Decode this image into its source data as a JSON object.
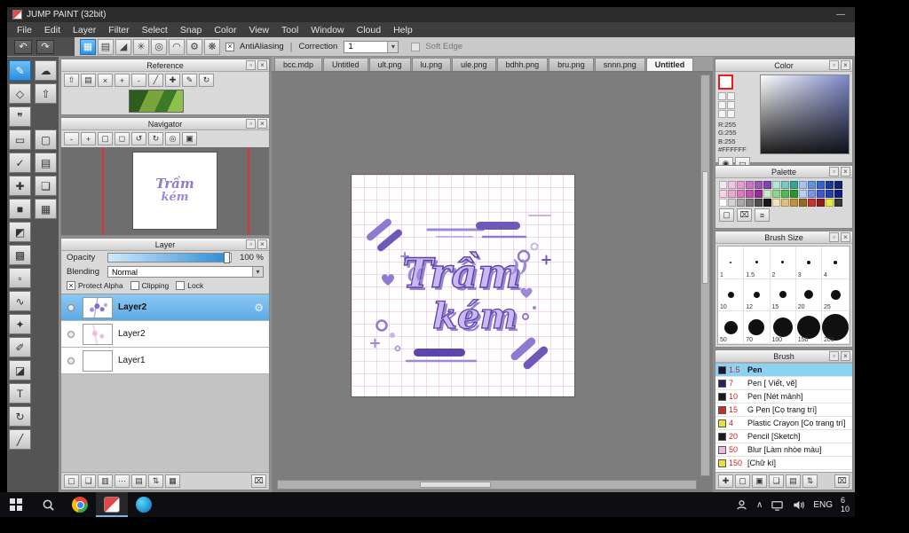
{
  "ui": {
    "dock_glyph": "▫",
    "close_glyph": "×",
    "dropdown_arrow": "▾",
    "check_glyph": "×",
    "gear_glyph": "⚙",
    "undo_glyph": "↶",
    "redo_glyph": "↷",
    "separator": "|",
    "chevron_up_glyph": "∧",
    "palette_lines_glyph": "≡"
  },
  "window": {
    "title": "JUMP PAINT (32bit)",
    "minimize_glyph": "—"
  },
  "menu": {
    "items": [
      "File",
      "Edit",
      "Layer",
      "Filter",
      "Select",
      "Snap",
      "Color",
      "View",
      "Tool",
      "Window",
      "Cloud",
      "Help"
    ]
  },
  "toolbar": {
    "buttons": [
      {
        "name": "snap-off-button",
        "glyph": "▦",
        "selected": true
      },
      {
        "name": "snap-grid-button",
        "glyph": "▤"
      },
      {
        "name": "snap-perspective-button",
        "glyph": "◢"
      },
      {
        "name": "snap-radial-button",
        "glyph": "✳"
      },
      {
        "name": "snap-circle-button",
        "glyph": "◎"
      },
      {
        "name": "snap-curve-button",
        "glyph": "◠"
      },
      {
        "name": "snap-settings-button",
        "glyph": "⚙"
      },
      {
        "name": "snap-special-button",
        "glyph": "❋"
      }
    ],
    "antialiasing_label": "AntiAliasing",
    "antialiasing_checked": true,
    "correction_label": "Correction",
    "correction_value": "1",
    "soft_edge_label": "Soft Edge",
    "soft_edge_checked": false
  },
  "tools": {
    "items": [
      {
        "name": "brush-tool",
        "glyph": "✎",
        "selected": true
      },
      {
        "name": "smudge-tool",
        "glyph": "☁"
      },
      {
        "name": "eraser-tool",
        "glyph": "◇"
      },
      {
        "name": "upload-tool",
        "glyph": "⇧"
      },
      {
        "name": "speech-bubble-tool",
        "glyph": "❞"
      },
      null,
      {
        "name": "shape-rect-tool",
        "glyph": "▭"
      },
      {
        "name": "rounded-rect-tool",
        "glyph": "▢"
      },
      {
        "name": "pen-check-tool",
        "glyph": "✓"
      },
      {
        "name": "document-tool",
        "glyph": "▤"
      },
      {
        "name": "move-tool",
        "glyph": "✚"
      },
      {
        "name": "layers-tool",
        "glyph": "❏"
      },
      {
        "name": "fill-rect-tool",
        "glyph": "■"
      },
      {
        "name": "grid-tool",
        "glyph": "▦"
      },
      {
        "name": "bucket-tool",
        "glyph": "◩"
      },
      null,
      {
        "name": "gradient-tool",
        "glyph": "▩"
      },
      null,
      {
        "name": "marquee-select-tool",
        "glyph": "▫"
      },
      null,
      {
        "name": "lasso-tool",
        "glyph": "∿"
      },
      null,
      {
        "name": "magic-wand-tool",
        "glyph": "✦"
      },
      null,
      {
        "name": "select-pen-tool",
        "glyph": "✐"
      },
      null,
      {
        "name": "select-eraser-tool",
        "glyph": "◪"
      },
      null,
      {
        "name": "text-tool",
        "glyph": "T"
      },
      null,
      {
        "name": "rotate-tool",
        "glyph": "↻"
      },
      null,
      {
        "name": "slice-tool",
        "glyph": "╱"
      },
      null
    ]
  },
  "panels": {
    "reference": {
      "title": "Reference",
      "buttons": [
        {
          "name": "ref-up-button",
          "glyph": "⇧"
        },
        {
          "name": "ref-folder-button",
          "glyph": "▤"
        },
        {
          "name": "ref-clear-button",
          "glyph": "×"
        },
        {
          "name": "ref-zoom-in-button",
          "glyph": "+"
        },
        {
          "name": "ref-zoom-out-button",
          "glyph": "-"
        },
        {
          "name": "ref-eyedropper-button",
          "glyph": "╱"
        },
        {
          "name": "ref-hand-button",
          "glyph": "✚"
        },
        {
          "name": "ref-pen-button",
          "glyph": "✎"
        },
        {
          "name": "ref-rotate-button",
          "glyph": "↻"
        }
      ]
    },
    "navigator": {
      "title": "Navigator",
      "buttons": [
        {
          "name": "nav-zoom-out-button",
          "glyph": "-"
        },
        {
          "name": "nav-zoom-in-button",
          "glyph": "+"
        },
        {
          "name": "nav-fit-button",
          "glyph": "▢"
        },
        {
          "name": "nav-actual-size-button",
          "glyph": "◻"
        },
        {
          "name": "nav-rotate-left-button",
          "glyph": "↺"
        },
        {
          "name": "nav-rotate-right-button",
          "glyph": "↻"
        },
        {
          "name": "nav-reset-button",
          "glyph": "◎"
        },
        {
          "name": "nav-lock-button",
          "glyph": "▣"
        }
      ]
    },
    "layer": {
      "title": "Layer",
      "opacity_label": "Opacity",
      "opacity_value": "100 %",
      "blending_label": "Blending",
      "blending_value": "Normal",
      "protect_alpha_label": "Protect Alpha",
      "protect_alpha_checked": true,
      "clipping_label": "Clipping",
      "clipping_checked": false,
      "lock_label": "Lock",
      "lock_checked": false,
      "layers": [
        {
          "name": "Layer2",
          "thumb": "art",
          "selected": true
        },
        {
          "name": "Layer2",
          "thumb": "pink",
          "selected": false
        },
        {
          "name": "Layer1",
          "thumb": "blank",
          "selected": false
        }
      ],
      "buttons": [
        {
          "name": "layer-new-button",
          "glyph": "▢"
        },
        {
          "name": "layer-duplicate-button",
          "glyph": "❏"
        },
        {
          "name": "layer-merge-button",
          "glyph": "▥"
        },
        {
          "name": "layer-more-button",
          "glyph": "⋯"
        },
        {
          "name": "layer-folder-button",
          "glyph": "▤"
        },
        {
          "name": "layer-move-up-button",
          "glyph": "⇅"
        },
        {
          "name": "layer-combine-button",
          "glyph": "▦"
        },
        {
          "name": "layer-trash-button",
          "glyph": "⌧"
        }
      ]
    },
    "color": {
      "title": "Color",
      "r_label": "R:255",
      "g_label": "G:255",
      "b_label": "B:255",
      "hex_label": "#FFFFFF",
      "current_color": "#ffffff",
      "buttons": [
        {
          "name": "color-wheel-button",
          "glyph": "◉"
        },
        {
          "name": "color-bar-button",
          "glyph": "▭"
        }
      ]
    },
    "palette": {
      "title": "Palette",
      "swatches": [
        "#f2e6f2",
        "#eec6e4",
        "#e49ed2",
        "#c878c0",
        "#a05ab4",
        "#7c48a8",
        "#b4e4dc",
        "#7cc8bc",
        "#3ca094",
        "#a8c4ec",
        "#6490dc",
        "#3464c4",
        "#1c3c9c",
        "#102468",
        "#f6d2e2",
        "#eaaad0",
        "#d87cbc",
        "#c054ac",
        "#982c94",
        "#cceac4",
        "#92d488",
        "#54b850",
        "#289828",
        "#bccef4",
        "#7c94e4",
        "#4058cc",
        "#2840ac",
        "#141c7c",
        "#ffffff",
        "#d4d4d4",
        "#a8a8a8",
        "#7c7c7c",
        "#505050",
        "#181818",
        "#f2e2b4",
        "#dcc07c",
        "#bc9440",
        "#986c20",
        "#c43434",
        "#8c1c1c",
        "#e8e83c",
        "#383838"
      ],
      "buttons": [
        {
          "name": "palette-new-button",
          "glyph": "▢"
        },
        {
          "name": "palette-trash-button",
          "glyph": "⌧"
        },
        {
          "name": "palette-menu-button",
          "glyph": "≡"
        }
      ]
    },
    "brush_size": {
      "title": "Brush Size",
      "sizes": [
        "1",
        "1.5",
        "2",
        "3",
        "4",
        "10",
        "12",
        "15",
        "20",
        "25",
        "50",
        "70",
        "100",
        "150",
        "200"
      ]
    },
    "brush": {
      "title": "Brush",
      "items": [
        {
          "size": "1.5",
          "name": "Pen",
          "chip": "#16162e",
          "selected": true
        },
        {
          "size": "7",
          "name": "Pen [ Viết, vẽ]",
          "chip": "#23235e",
          "selected": false
        },
        {
          "size": "10",
          "name": "Pen [Nét mảnh]",
          "chip": "#1a1a1a",
          "selected": false
        },
        {
          "size": "15",
          "name": "G Pen [Cọ trang trí]",
          "chip": "#cc2b2b",
          "selected": false
        },
        {
          "size": "4",
          "name": "Plastic Crayon [Cọ trang trí]",
          "chip": "#e6e23c",
          "selected": false
        },
        {
          "size": "20",
          "name": "Pencil [Sketch]",
          "chip": "#1a1a1a",
          "selected": false
        },
        {
          "size": "50",
          "name": "Blur [Làm nhòe màu]",
          "chip": "#f2b7dd",
          "selected": false
        },
        {
          "size": "150",
          "name": "[Chữ kí]",
          "chip": "#e6e23c",
          "selected": false
        }
      ],
      "buttons": [
        {
          "name": "brush-add-button",
          "glyph": "✚"
        },
        {
          "name": "brush-new-button",
          "glyph": "▢"
        },
        {
          "name": "brush-save-button",
          "glyph": "▣"
        },
        {
          "name": "brush-duplicate-button",
          "glyph": "❏"
        },
        {
          "name": "brush-folder-button",
          "glyph": "▤"
        },
        {
          "name": "brush-sort-button",
          "glyph": "⇅"
        },
        {
          "name": "brush-trash-button",
          "glyph": "⌧"
        }
      ]
    }
  },
  "canvas": {
    "tabs": [
      {
        "label": "bcc.mdp",
        "active": false
      },
      {
        "label": "Untitled",
        "active": false
      },
      {
        "label": "ult.png",
        "active": false
      },
      {
        "label": "lu.png",
        "active": false
      },
      {
        "label": "ule.png",
        "active": false
      },
      {
        "label": "bdhh.png",
        "active": false
      },
      {
        "label": "bru.png",
        "active": false
      },
      {
        "label": "snnn.png",
        "active": false
      },
      {
        "label": "Untitled",
        "active": true
      }
    ],
    "artwork": {
      "word1": "Trầm",
      "word2": "kém"
    }
  },
  "taskbar": {
    "lang": "ENG",
    "clock_line1": "6",
    "clock_line2": "10"
  }
}
